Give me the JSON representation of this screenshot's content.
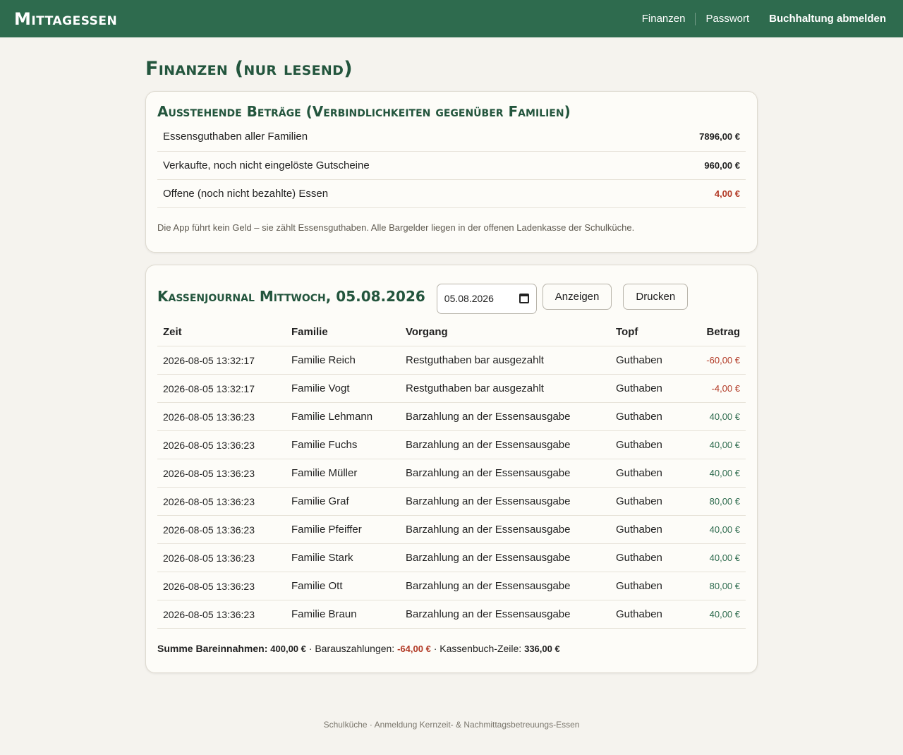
{
  "header": {
    "brand": "Mittagessen",
    "nav": {
      "finanzen": "Finanzen",
      "passwort": "Passwort",
      "logout": "Buchhaltung abmelden"
    }
  },
  "page": {
    "title": "Finanzen (nur lesend)"
  },
  "outstanding": {
    "title": "Ausstehende Beträge (Verbindlichkeiten gegenüber Familien)",
    "rows": [
      {
        "label": "Essensguthaben aller Familien",
        "amount": "7896,00 €"
      },
      {
        "label": "Verkaufte, noch nicht eingelöste Gutscheine",
        "amount": "960,00 €"
      },
      {
        "label": "Offene (noch nicht bezahlte) Essen",
        "amount": "4,00 €"
      }
    ],
    "note": "Die App führt kein Geld – sie zählt Essensguthaben. Alle Bargelder liegen in der offenen Ladenkasse der Schulküche."
  },
  "journal": {
    "title": "Kassenjournal Mittwoch, 05.08.2026",
    "date_value": "05.08.2026",
    "show_button": "Anzeigen",
    "print_button": "Drucken",
    "columns": {
      "time": "Zeit",
      "family": "Familie",
      "action": "Vorgang",
      "pot": "Topf",
      "amount": "Betrag"
    },
    "rows": [
      {
        "time": "2026-08-05 13:32:17",
        "family": "Familie Reich",
        "action": "Restguthaben bar ausgezahlt",
        "pot": "Guthaben",
        "amount": "-60,00 €"
      },
      {
        "time": "2026-08-05 13:32:17",
        "family": "Familie Vogt",
        "action": "Restguthaben bar ausgezahlt",
        "pot": "Guthaben",
        "amount": "-4,00 €"
      },
      {
        "time": "2026-08-05 13:36:23",
        "family": "Familie Lehmann",
        "action": "Barzahlung an der Essensausgabe",
        "pot": "Guthaben",
        "amount": "40,00 €"
      },
      {
        "time": "2026-08-05 13:36:23",
        "family": "Familie Fuchs",
        "action": "Barzahlung an der Essensausgabe",
        "pot": "Guthaben",
        "amount": "40,00 €"
      },
      {
        "time": "2026-08-05 13:36:23",
        "family": "Familie Müller",
        "action": "Barzahlung an der Essensausgabe",
        "pot": "Guthaben",
        "amount": "40,00 €"
      },
      {
        "time": "2026-08-05 13:36:23",
        "family": "Familie Graf",
        "action": "Barzahlung an der Essensausgabe",
        "pot": "Guthaben",
        "amount": "80,00 €"
      },
      {
        "time": "2026-08-05 13:36:23",
        "family": "Familie Pfeiffer",
        "action": "Barzahlung an der Essensausgabe",
        "pot": "Guthaben",
        "amount": "40,00 €"
      },
      {
        "time": "2026-08-05 13:36:23",
        "family": "Familie Stark",
        "action": "Barzahlung an der Essensausgabe",
        "pot": "Guthaben",
        "amount": "40,00 €"
      },
      {
        "time": "2026-08-05 13:36:23",
        "family": "Familie Ott",
        "action": "Barzahlung an der Essensausgabe",
        "pot": "Guthaben",
        "amount": "80,00 €"
      },
      {
        "time": "2026-08-05 13:36:23",
        "family": "Familie Braun",
        "action": "Barzahlung an der Essensausgabe",
        "pot": "Guthaben",
        "amount": "40,00 €"
      }
    ],
    "totals": {
      "income_label": "Summe Bareinnahmen:",
      "income_value": "400,00 €",
      "payout_label": "Barauszahlungen:",
      "payout_value": "-64,00 €",
      "line_label": "Kassenbuch-Zeile:",
      "line_value": "336,00 €"
    }
  },
  "footer": {
    "text": "Schulküche · Anmeldung Kernzeit- & Nachmittagsbetreuungs-Essen"
  },
  "colors": {
    "header_bg": "#2e6b4e",
    "heading": "#23553d",
    "negative": "#b23a26",
    "positive": "#2e6b4e"
  }
}
